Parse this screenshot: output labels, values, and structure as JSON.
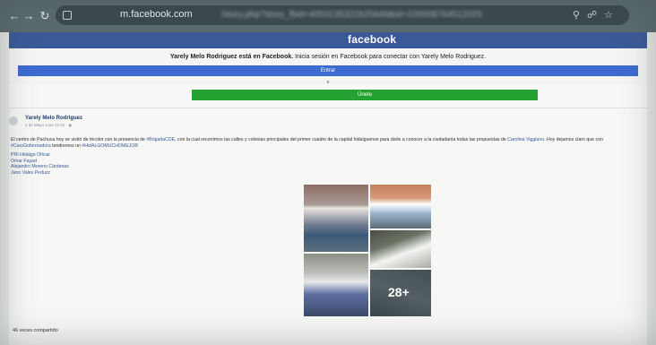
{
  "browser": {
    "url_domain": "m.facebook.com",
    "url_path": "/story.php?story_fbid=4053135322625649&id=100008764512025"
  },
  "header": {
    "logo": "facebook"
  },
  "banner": {
    "title_bold": "Yarely Melo Rodriguez está en Facebook.",
    "title_rest": " Inicia sesión en Facebook para conectar con Yarely Melo Rodriguez.",
    "login_button": "Entrar",
    "or_text": "o",
    "join_button": "Únete"
  },
  "post": {
    "author": "Yarely Melo Rodriguez",
    "time": "4 de Mayo a las 22:10 · ",
    "body_1": "El centro de Pachuca hoy se vistió de tricolor con la presencia de ",
    "hashtag_1": "#BrigadaCDE",
    "body_2": ", con la cual recorrimos las calles y colonias principales del primer cuadro de la capital hidalguense para darle a conocer a la ciudadanía todas las propuestas de ",
    "link_name": "Carolina Viggiano",
    "body_3": ". Hoy dejamos claro que con ",
    "hashtag_2": "#CaroGobernadora",
    "body_4": " tendremos un ",
    "hashtag_3": "#HidALGOMUCHOMEJOR",
    "mentions": [
      "PRI Hidalgo Oficial",
      "Omar Fayad",
      "Alejandro Moreno Cárdenas",
      "Jano Vales Peduzz"
    ],
    "photo_more": "28+",
    "shares": "46 veces compartido"
  }
}
